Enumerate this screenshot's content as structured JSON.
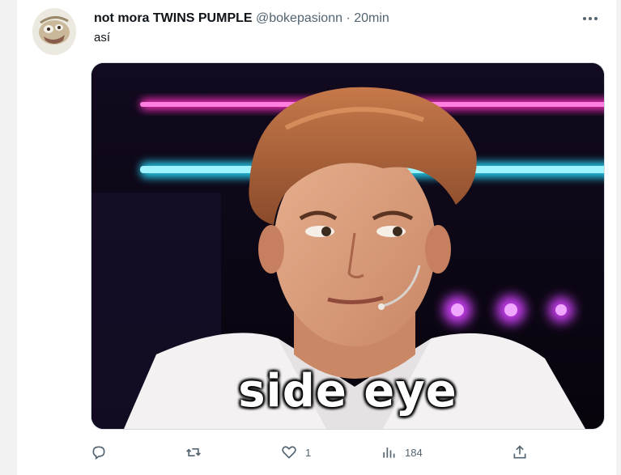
{
  "tweet": {
    "display_name": "not mora TWINS PUMPLE",
    "handle": "@bokepasionn",
    "separator": "·",
    "time": "20min",
    "text": "así",
    "media_caption": "side eye"
  },
  "actions": {
    "reply_count": "",
    "retweet_count": "",
    "like_count": "1",
    "view_count": "184"
  },
  "icons": [
    "avatar",
    "more-icon",
    "reply-icon",
    "retweet-icon",
    "like-icon",
    "views-icon",
    "share-icon"
  ],
  "colors": {
    "text": "#0f1419",
    "secondary": "#536471",
    "neon_pink": "#ff2fc0",
    "neon_cyan": "#26d6f5"
  }
}
